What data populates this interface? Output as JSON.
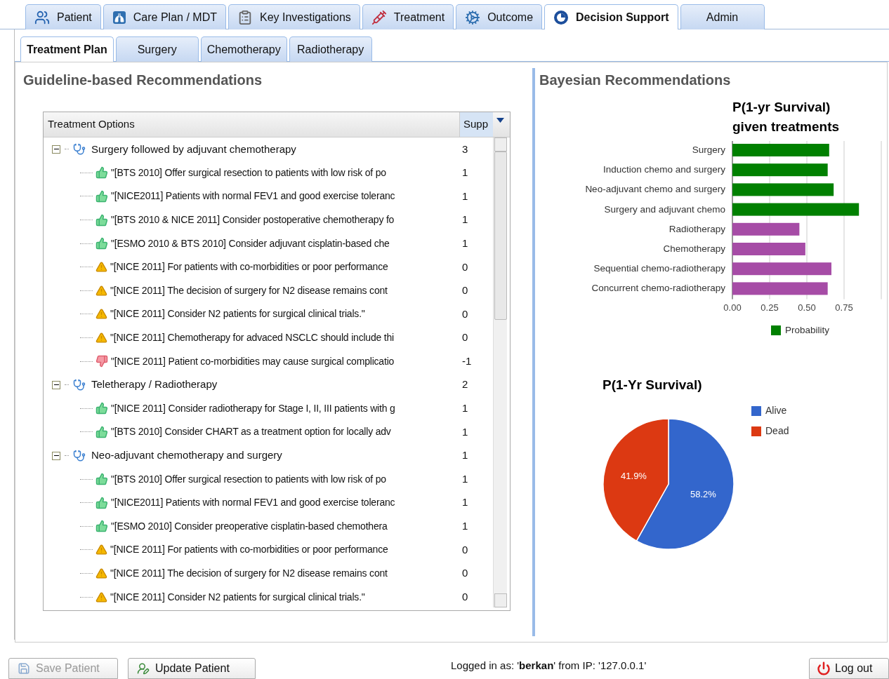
{
  "main_tabs": [
    {
      "label": "Patient",
      "selected": false
    },
    {
      "label": "Care Plan / MDT",
      "selected": false
    },
    {
      "label": "Key Investigations",
      "selected": false
    },
    {
      "label": "Treatment",
      "selected": false
    },
    {
      "label": "Outcome",
      "selected": false
    },
    {
      "label": "Decision Support",
      "selected": true
    },
    {
      "label": "Admin",
      "selected": false
    }
  ],
  "sub_tabs": [
    {
      "label": "Treatment Plan",
      "selected": true
    },
    {
      "label": "Surgery",
      "selected": false
    },
    {
      "label": "Chemotherapy",
      "selected": false
    },
    {
      "label": "Radiotherapy",
      "selected": false
    }
  ],
  "guideline_panel": {
    "title": "Guideline-based Recommendations",
    "tree": {
      "columns": [
        "Treatment Options",
        "Supp"
      ],
      "rows": [
        {
          "kind": "group",
          "text": "Surgery followed by adjuvant chemotherapy",
          "support": "3",
          "expanded": true,
          "children": [
            {
              "kind": "for",
              "text": "\"[BTS 2010] Offer surgical resection to patients with low risk of po",
              "support": "1"
            },
            {
              "kind": "for",
              "text": "\"[NICE2011] Patients with normal FEV1 and good exercise toleranc",
              "support": "1"
            },
            {
              "kind": "for",
              "text": "\"[BTS 2010 & NICE 2011] Consider postoperative chemotherapy fo",
              "support": "1"
            },
            {
              "kind": "for",
              "text": "\"[ESMO 2010 & BTS 2010] Consider adjuvant cisplatin-based che",
              "support": "1"
            },
            {
              "kind": "warning",
              "text": "\"[NICE 2011] For patients with co-morbidities or poor performance",
              "support": "0"
            },
            {
              "kind": "warning",
              "text": "\"[NICE 2011] The decision of surgery for N2 disease remains cont",
              "support": "0"
            },
            {
              "kind": "warning",
              "text": "\"[NICE 2011] Consider N2 patients for surgical clinical trials.\"",
              "support": "0"
            },
            {
              "kind": "warning",
              "text": "\"[NICE 2011] Chemotherapy for advaced NSCLC should include thi",
              "support": "0"
            },
            {
              "kind": "against",
              "text": "\"[NICE 2011] Patient co-morbidities may cause surgical complicatio",
              "support": "-1"
            }
          ]
        },
        {
          "kind": "group",
          "text": "Teletherapy / Radiotherapy",
          "support": "2",
          "expanded": true,
          "children": [
            {
              "kind": "for",
              "text": "\"[NICE 2011] Consider radiotherapy for Stage I, II, III patients with g",
              "support": "1"
            },
            {
              "kind": "for",
              "text": "\"[BTS 2010] Consider CHART as a treatment option for locally adv",
              "support": "1"
            }
          ]
        },
        {
          "kind": "group",
          "text": "Neo-adjuvant chemotherapy and surgery",
          "support": "1",
          "expanded": true,
          "children": [
            {
              "kind": "for",
              "text": "\"[BTS 2010] Offer surgical resection to patients with low risk of po",
              "support": "1"
            },
            {
              "kind": "for",
              "text": "\"[NICE2011] Patients with normal FEV1 and good exercise toleranc",
              "support": "1"
            },
            {
              "kind": "for",
              "text": "\"[ESMO 2010] Consider preoperative cisplatin-based chemothera",
              "support": "1"
            },
            {
              "kind": "warning",
              "text": "\"[NICE 2011] For patients with co-morbidities or poor performance",
              "support": "0"
            },
            {
              "kind": "warning",
              "text": "\"[NICE 2011] The decision of surgery for N2 disease remains cont",
              "support": "0"
            },
            {
              "kind": "warning",
              "text": "\"[NICE 2011] Consider N2 patients for surgical clinical trials.\"",
              "support": "0"
            }
          ]
        }
      ]
    }
  },
  "bayesian_panel": {
    "title": "Bayesian Recommendations",
    "bar_chart": {
      "chart_data": {
        "type": "bar",
        "orientation": "horizontal",
        "title": "P(1-yr Survival) given treatments",
        "categories": [
          "Surgery",
          "Induction chemo and surgery",
          "Neo-adjuvant chemo and surgery",
          "Surgery and adjuvant chemo",
          "Radiotherapy",
          "Chemotherapy",
          "Sequential chemo-radiotherapy",
          "Concurrent chemo-radiotherapy"
        ],
        "series": [
          {
            "name": "Probability",
            "color": "#008000",
            "values": [
              0.65,
              0.64,
              0.68,
              0.85,
              null,
              null,
              null,
              null
            ]
          },
          {
            "color": "#a64ca6",
            "values": [
              null,
              null,
              null,
              null,
              0.45,
              0.49,
              0.665,
              0.64
            ]
          }
        ],
        "xlim": [
          0,
          1
        ],
        "grid": true,
        "legend": true,
        "xticks": [
          {
            "value": 0,
            "label": "0.00"
          },
          {
            "value": 0.25,
            "label": "0.25"
          },
          {
            "value": 0.5,
            "label": "0.50"
          },
          {
            "value": 0.75,
            "label": "0.75"
          }
        ]
      }
    },
    "pie_chart": {
      "chart_data": {
        "type": "pie",
        "title": "P(1-Yr Survival)",
        "legend": true,
        "categories": [
          "Alive",
          "Dead"
        ],
        "values": [
          58.2,
          41.9
        ],
        "value_labels": [
          "58.2%",
          "41.9%"
        ]
      }
    }
  },
  "footer": {
    "buttons": [
      {
        "label": "Save Patient",
        "disabled": true
      },
      {
        "label": "Update Patient",
        "disabled": false
      }
    ],
    "login_status": "Logged in as: '**berkan**' from IP: '127.0.0.1'",
    "logout": "Log out"
  }
}
